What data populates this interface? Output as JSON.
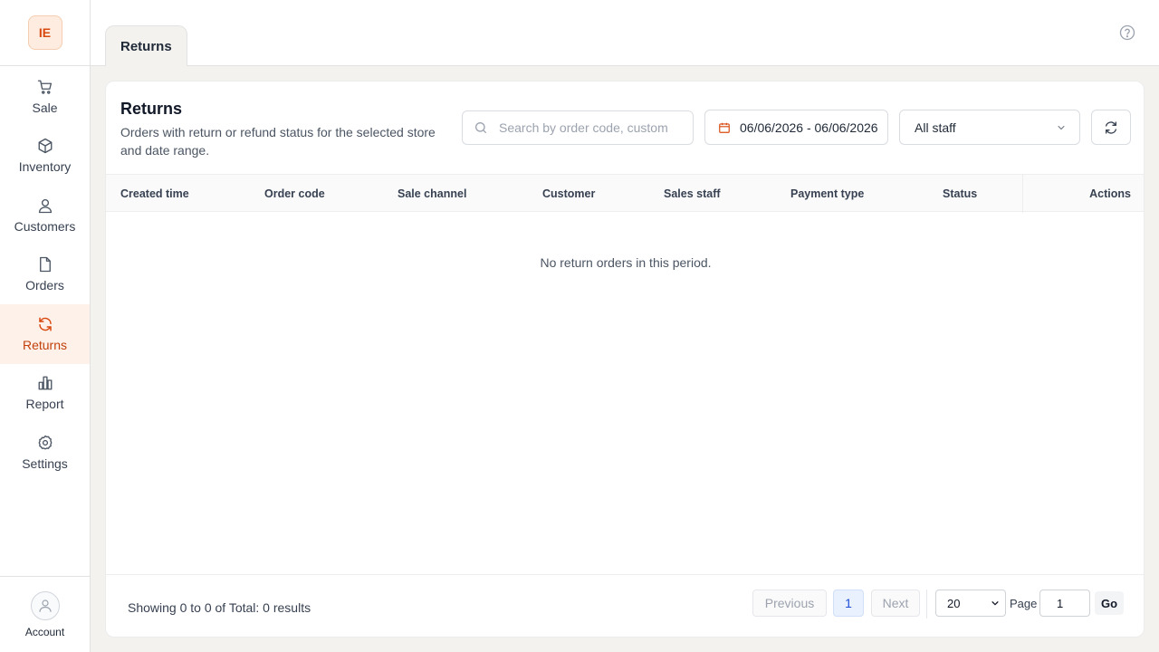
{
  "app": {
    "logo_text": "IE"
  },
  "sidebar": {
    "items": [
      {
        "label": "Sale",
        "icon": "cart-icon"
      },
      {
        "label": "Inventory",
        "icon": "box-icon"
      },
      {
        "label": "Customers",
        "icon": "user-icon"
      },
      {
        "label": "Orders",
        "icon": "document-icon"
      },
      {
        "label": "Returns",
        "icon": "refresh-icon",
        "active": true
      },
      {
        "label": "Report",
        "icon": "bar-chart-icon"
      },
      {
        "label": "Settings",
        "icon": "gear-icon"
      }
    ],
    "account_label": "Account"
  },
  "topbar": {
    "tab_label": "Returns",
    "help_icon": "help-circle-icon"
  },
  "page": {
    "title": "Returns",
    "subtitle": "Orders with return or refund status for the selected store and date range."
  },
  "filters": {
    "search_placeholder": "Search by order code, customer",
    "search_value": "",
    "date_range": "06/06/2026 - 06/06/2026",
    "staff_selected": "All staff"
  },
  "table": {
    "columns": [
      "Created time",
      "Order code",
      "Sale channel",
      "Customer",
      "Sales staff",
      "Payment type",
      "Status",
      "Actions"
    ],
    "rows": [],
    "empty_message": "No return orders in this period."
  },
  "pagination": {
    "summary": "Showing 0 to 0 of Total: 0 results",
    "previous_label": "Previous",
    "current_page": "1",
    "next_label": "Next",
    "page_size": "20",
    "page_label": "Page",
    "page_input_value": "1",
    "go_label": "Go"
  },
  "colors": {
    "accent": "#d9480f",
    "active_nav_bg": "#fdf1e9",
    "page_bg": "#f3f2ef",
    "current_page_bg": "#e8f1fd"
  }
}
